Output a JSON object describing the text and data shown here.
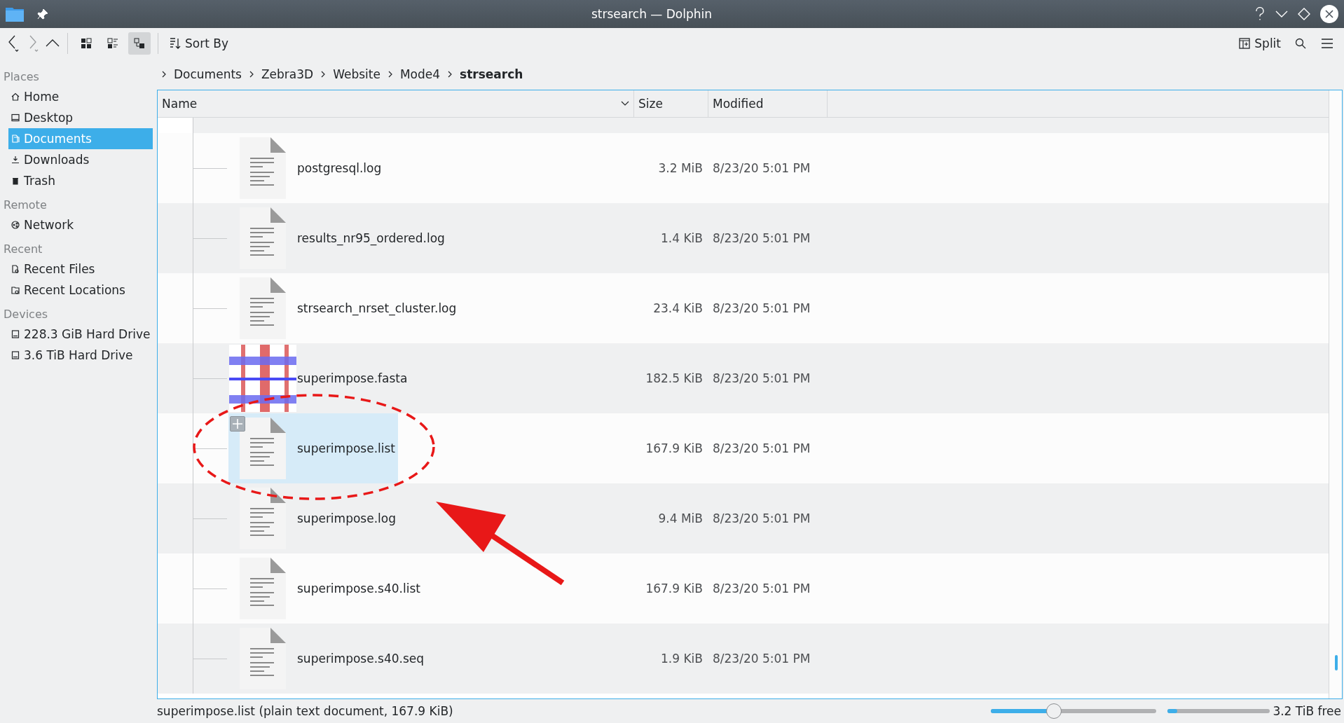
{
  "window": {
    "title": "strsearch — Dolphin"
  },
  "toolbar": {
    "view_modes": [
      {
        "kind": "icons",
        "selected": false
      },
      {
        "kind": "compact",
        "selected": false
      },
      {
        "kind": "details",
        "selected": true
      }
    ],
    "sort_label": "Sort By",
    "split_label": "Split"
  },
  "sidebar": {
    "sections": [
      {
        "title": "Places",
        "items": [
          {
            "label": "Home",
            "selected": false
          },
          {
            "label": "Desktop",
            "selected": false
          },
          {
            "label": "Documents",
            "selected": true
          },
          {
            "label": "Downloads",
            "selected": false
          },
          {
            "label": "Trash",
            "selected": false
          }
        ]
      },
      {
        "title": "Remote",
        "items": [
          {
            "label": "Network",
            "selected": false
          }
        ]
      },
      {
        "title": "Recent",
        "items": [
          {
            "label": "Recent Files",
            "selected": false
          },
          {
            "label": "Recent Locations",
            "selected": false
          }
        ]
      },
      {
        "title": "Devices",
        "items": [
          {
            "label": "228.3 GiB Hard Drive",
            "selected": false
          },
          {
            "label": "3.6 TiB Hard Drive",
            "selected": false
          }
        ]
      }
    ]
  },
  "breadcrumb": [
    {
      "label": "Documents",
      "current": false
    },
    {
      "label": "Zebra3D",
      "current": false
    },
    {
      "label": "Website",
      "current": false
    },
    {
      "label": "Mode4",
      "current": false
    },
    {
      "label": "strsearch",
      "current": true
    }
  ],
  "table": {
    "columns": [
      "Name",
      "Size",
      "Modified"
    ],
    "rows": [
      {
        "name": "postgresql.log",
        "size": "3.2 MiB",
        "modified": "8/23/20 5:01 PM",
        "kind": "text",
        "selected": false
      },
      {
        "name": "results_nr95_ordered.log",
        "size": "1.4 KiB",
        "modified": "8/23/20 5:01 PM",
        "kind": "text",
        "selected": false
      },
      {
        "name": "strsearch_nrset_cluster.log",
        "size": "23.4 KiB",
        "modified": "8/23/20 5:01 PM",
        "kind": "text",
        "selected": false
      },
      {
        "name": "superimpose.fasta",
        "size": "182.5 KiB",
        "modified": "8/23/20 5:01 PM",
        "kind": "image",
        "selected": false
      },
      {
        "name": "superimpose.list",
        "size": "167.9 KiB",
        "modified": "8/23/20 5:01 PM",
        "kind": "text",
        "selected": true
      },
      {
        "name": "superimpose.log",
        "size": "9.4 MiB",
        "modified": "8/23/20 5:01 PM",
        "kind": "text",
        "selected": false
      },
      {
        "name": "superimpose.s40.list",
        "size": "167.9 KiB",
        "modified": "8/23/20 5:01 PM",
        "kind": "text",
        "selected": false
      },
      {
        "name": "superimpose.s40.seq",
        "size": "1.9 KiB",
        "modified": "8/23/20 5:01 PM",
        "kind": "text",
        "selected": false
      }
    ]
  },
  "status_bar": {
    "text": "superimpose.list (plain text document, 167.9 KiB)",
    "zoom": {
      "level": 0.38
    },
    "free_space": {
      "level": 0.09,
      "text": "3.2 TiB free"
    }
  }
}
